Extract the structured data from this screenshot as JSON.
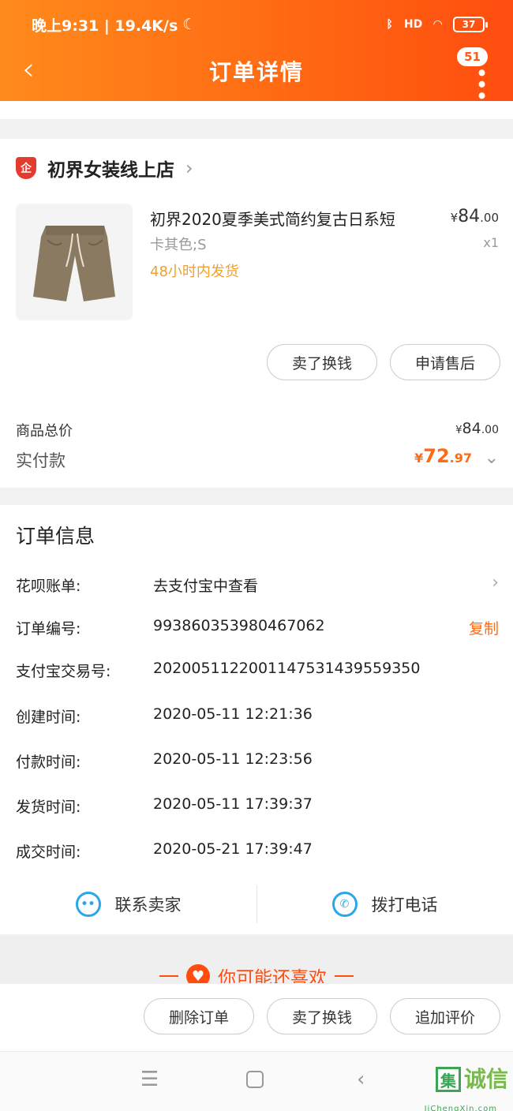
{
  "status_bar": {
    "time_speed": "晚上9:31 | 19.4K/s",
    "network": "HD",
    "battery": "37"
  },
  "header": {
    "title": "订单详情",
    "badge_count": "51"
  },
  "shop": {
    "logo_text": "企",
    "name": "初界女装线上店"
  },
  "product": {
    "title": "初界2020夏季美式简约复古日系短",
    "spec": "卡其色;S",
    "shipping": "48小时内发货",
    "price_symbol": "¥",
    "price_int": "84",
    "price_dec": ".00",
    "qty": "x1"
  },
  "item_actions": {
    "sell_label": "卖了换钱",
    "after_sale_label": "申请售后"
  },
  "summary": {
    "total_label": "商品总价",
    "total_symbol": "¥",
    "total_int": "84",
    "total_dec": ".00",
    "paid_label": "实付款",
    "paid_symbol": "¥",
    "paid_int": "72",
    "paid_dec": ".97"
  },
  "order_info": {
    "title": "订单信息",
    "huabei_label": "花呗账单:",
    "huabei_value": "去支付宝中查看",
    "order_no_label": "订单编号:",
    "order_no_value": "993860353980467062",
    "copy_label": "复制",
    "alipay_label": "支付宝交易号:",
    "alipay_value": "2020051122001147531439559350",
    "created_label": "创建时间:",
    "created_value": "2020-05-11 12:21:36",
    "paid_label": "付款时间:",
    "paid_value": "2020-05-11 12:23:56",
    "shipped_label": "发货时间:",
    "shipped_value": "2020-05-11 17:39:37",
    "completed_label": "成交时间:",
    "completed_value": "2020-05-21 17:39:47"
  },
  "contact": {
    "seller_label": "联系卖家",
    "phone_label": "拨打电话"
  },
  "recommend": {
    "label": "你可能还喜欢"
  },
  "bottom_actions": {
    "delete_label": "删除订单",
    "sell_label": "卖了换钱",
    "review_label": "追加评价"
  },
  "watermark": {
    "box_char": "集",
    "text": "诚信",
    "sub": "JiChengXin.com"
  },
  "colors": {
    "accent": "#ff6a13",
    "header_start": "#ff8a1c",
    "header_end": "#ff4d10",
    "shipping": "#f0a030",
    "contact_icon": "#2aa7e8"
  }
}
